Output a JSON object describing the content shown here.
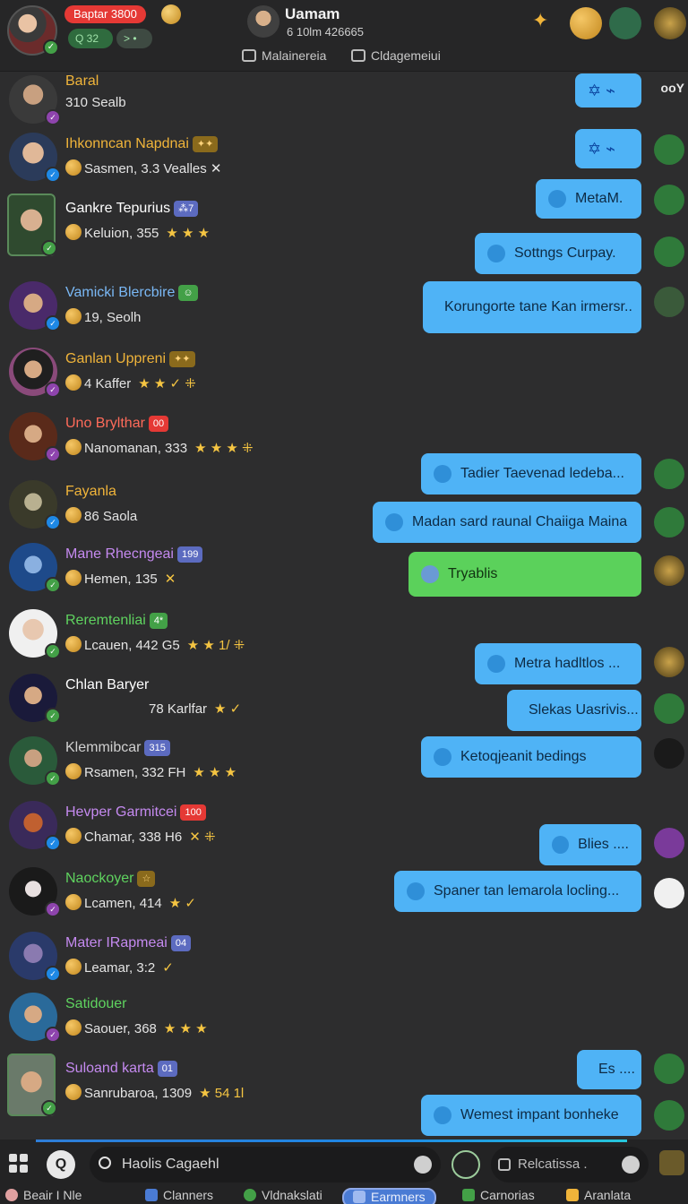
{
  "header": {
    "badge_label": "Baptar 3800",
    "pill_green": "Q 32",
    "pill_dark": "> •",
    "title": "Uamam",
    "subtitle": "6 10lm 426665",
    "link1": "Malainereia",
    "link2": "Cldagemeiui"
  },
  "contacts": [
    {
      "name": "Baral",
      "name_color": "#f0b43a",
      "sub": "310 Sealb",
      "status": "purple",
      "tag": "",
      "tag_color": "",
      "sub_icons": ""
    },
    {
      "name": "Ihkonncan Napdnai",
      "name_color": "#f0b43a",
      "sub": "Sasmen, 3.3 Vealles ✕",
      "status": "blue",
      "tag": "✦✦",
      "tag_color": "gold",
      "sub_icons": ""
    },
    {
      "name": "Gankre Tepurius",
      "name_color": "#ffffff",
      "sub": "Keluion, 355",
      "status": "green",
      "tag": "⁂7",
      "tag_color": "blue",
      "sub_icons": "★ ★ ★"
    },
    {
      "name": "Vamicki Blercbire",
      "name_color": "#7ab8f5",
      "sub": "19, Seolh",
      "status": "blue",
      "tag": "☺",
      "tag_color": "green",
      "sub_icons": ""
    },
    {
      "name": "Ganlan Uppreni",
      "name_color": "#f0b43a",
      "sub": "4   Kaffer",
      "status": "purple",
      "tag": "✦✦",
      "tag_color": "gold",
      "sub_icons": "★ ★ ✓ ⁜"
    },
    {
      "name": "Uno Brylthar",
      "name_color": "#ff6b5a",
      "sub": "Nanomanan, 333",
      "status": "purple",
      "tag": "00",
      "tag_color": "red",
      "sub_icons": "★ ★ ★ ⁜"
    },
    {
      "name": "Fayanla",
      "name_color": "#f0b43a",
      "sub": "86 Saola",
      "status": "blue",
      "tag": "",
      "tag_color": "",
      "sub_icons": ""
    },
    {
      "name": "Mane Rhecngeai",
      "name_color": "#c58af0",
      "sub": "Hemen, 135",
      "status": "green",
      "tag": "199",
      "tag_color": "blue",
      "sub_icons": "✕"
    },
    {
      "name": "Reremtenliai",
      "name_color": "#5fd35f",
      "sub": "Lcauen, 442  G5",
      "status": "green",
      "tag": "4*",
      "tag_color": "green",
      "sub_icons": "★ ★ 1/ ⁜"
    },
    {
      "name": "Chlan Baryer",
      "name_color": "#ffffff",
      "sub": "78 Karlfar",
      "status": "green",
      "tag": "",
      "tag_color": "",
      "sub_icons": "★ ✓"
    },
    {
      "name": "Klemmibcar",
      "name_color": "#d0d0d0",
      "sub": "Rsamen, 332  FH",
      "status": "green",
      "tag": "315",
      "tag_color": "blue",
      "sub_icons": "★ ★ ★"
    },
    {
      "name": "Hevper Garmitcei",
      "name_color": "#c58af0",
      "sub": "Chamar, 338  H6",
      "status": "blue",
      "tag": "100",
      "tag_color": "red",
      "sub_icons": "✕ ⁜"
    },
    {
      "name": "Naockoyer",
      "name_color": "#5fd35f",
      "sub": "Lcamen, 414",
      "status": "purple",
      "tag": "☆",
      "tag_color": "gold",
      "sub_icons": "★ ✓"
    },
    {
      "name": "Mater IRapmeai",
      "name_color": "#c58af0",
      "sub": "Leamar, 3:2",
      "status": "blue",
      "tag": "04",
      "tag_color": "blue",
      "sub_icons": "✓"
    },
    {
      "name": "Satidouer",
      "name_color": "#5fd35f",
      "sub": "Saouer, 368",
      "status": "purple",
      "tag": "",
      "tag_color": "",
      "sub_icons": "★ ★ ★"
    },
    {
      "name": "Suloand karta",
      "name_color": "#c58af0",
      "sub": "Sanrubaroa, 1309",
      "status": "green",
      "tag": "01",
      "tag_color": "blue",
      "sub_icons": "★ 54 1l"
    }
  ],
  "messages": [
    {
      "text": "",
      "icons": "✡ ⌁",
      "style": "blue"
    },
    {
      "text": "",
      "icons": "✡ ⌁",
      "style": "blue"
    },
    {
      "text": "MetaM.",
      "icons": "",
      "style": "blue"
    },
    {
      "text": "Sottngs Curpay.",
      "icons": "",
      "style": "blue"
    },
    {
      "text": "Korungorte tane Kan irmersr..",
      "icons": "",
      "style": "blue"
    },
    {
      "text": "Tadier Taevenad ledeba...",
      "icons": "",
      "style": "blue"
    },
    {
      "text": "Madan sard raunal Chaiiga Maina",
      "icons": "",
      "style": "blue"
    },
    {
      "text": "Tryablis",
      "icons": "",
      "style": "green"
    },
    {
      "text": "Metra hadltlos ...",
      "icons": "",
      "style": "blue"
    },
    {
      "text": "Slekas Uasrivis...",
      "icons": "",
      "style": "blue"
    },
    {
      "text": "Ketoqjeanit bedings",
      "icons": "",
      "style": "blue"
    },
    {
      "text": "Blies ....",
      "icons": "",
      "style": "blue"
    },
    {
      "text": "Spaner tan lemarola locling...",
      "icons": "",
      "style": "blue"
    },
    {
      "text": "Es ....",
      "icons": "",
      "style": "blue"
    },
    {
      "text": "Wemest impant bonheke",
      "icons": "",
      "style": "blue"
    }
  ],
  "overflow_label": "ooY",
  "bottom": {
    "search_placeholder": "Haolis Cagaehl",
    "search2_placeholder": "Relcatissa .",
    "tabs": [
      "Beair I Nle",
      "Clanners",
      "Vldnakslati",
      "Earmners",
      "Carnorias",
      "Aranlata"
    ]
  }
}
